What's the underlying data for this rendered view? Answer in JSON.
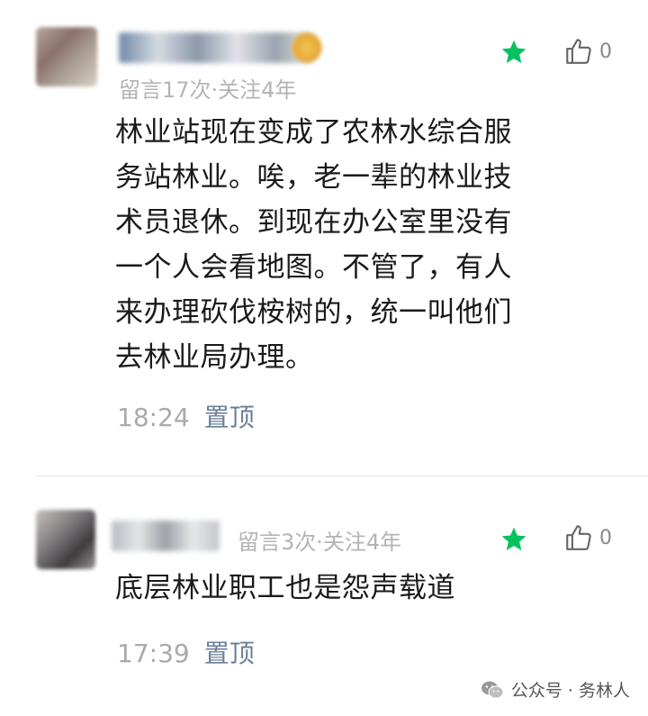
{
  "comments": [
    {
      "meta": "留言17次·关注4年",
      "like_count": "0",
      "lines": [
        "林业站现在变成了农林水综合服",
        "务站林业。唉，老一辈的林业技",
        "术员退休。到现在办公室里没有",
        "一个人会看地图。不管了，有人",
        "来办理砍伐桉树的，统一叫他们",
        "去林业局办理。"
      ],
      "time": "18:24",
      "pin_label": "置顶"
    },
    {
      "meta": "留言3次·关注4年",
      "like_count": "0",
      "lines": [
        "底层林业职工也是怨声载道"
      ],
      "time": "17:39",
      "pin_label": "置顶"
    }
  ],
  "watermark": "公众号 · 务林人",
  "colors": {
    "star": "#07c160",
    "pin": "#6b7f99",
    "meta": "#b4b4b4"
  }
}
